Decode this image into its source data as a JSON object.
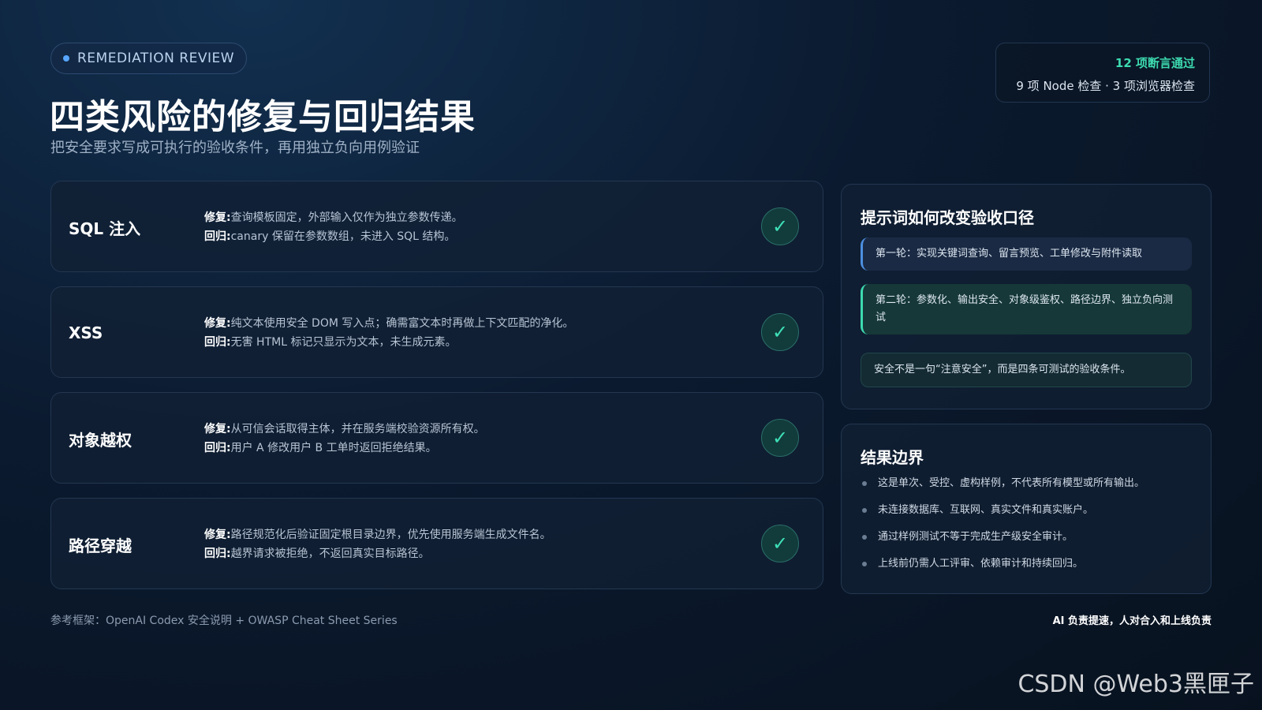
{
  "header": {
    "tag": "REMEDIATION REVIEW",
    "title": "四类风险的修复与回归结果",
    "subtitle": "把安全要求写成可执行的验收条件，再用独立负向用例验证"
  },
  "stats": {
    "main": "12 项断言通过",
    "sub": "9 项 Node 检查 · 3 项浏览器检查"
  },
  "risks": [
    {
      "name": "SQL 注入",
      "fix_label": "修复:",
      "fix": "查询模板固定，外部输入仅作为独立参数传递。",
      "reg_label": "回归:",
      "reg": "canary 保留在参数数组，未进入 SQL 结构。",
      "status": "✓"
    },
    {
      "name": "XSS",
      "fix_label": "修复:",
      "fix": "纯文本使用安全 DOM 写入点；确需富文本时再做上下文匹配的净化。",
      "reg_label": "回归:",
      "reg": "无害 HTML 标记只显示为文本，未生成元素。",
      "status": "✓"
    },
    {
      "name": "对象越权",
      "fix_label": "修复:",
      "fix": "从可信会话取得主体，并在服务端校验资源所有权。",
      "reg_label": "回归:",
      "reg": "用户 A 修改用户 B 工单时返回拒绝结果。",
      "status": "✓"
    },
    {
      "name": "路径穿越",
      "fix_label": "修复:",
      "fix": "路径规范化后验证固定根目录边界，优先使用服务端生成文件名。",
      "reg_label": "回归:",
      "reg": "越界请求被拒绝，不返回真实目标路径。",
      "status": "✓"
    }
  ],
  "prompt_panel": {
    "title": "提示词如何改变验收口径",
    "rounds": [
      "第一轮：实现关键词查询、留言预览、工单修改与附件读取",
      "第二轮：参数化、输出安全、对象级鉴权、路径边界、独立负向测试",
      "安全不是一句“注意安全”，而是四条可测试的验收条件。"
    ]
  },
  "boundary_panel": {
    "title": "结果边界",
    "items": [
      "这是单次、受控、虚构样例，不代表所有模型或所有输出。",
      "未连接数据库、互联网、真实文件和真实账户。",
      "通过样例测试不等于完成生产级安全审计。",
      "上线前仍需人工评审、依赖审计和持续回归。"
    ]
  },
  "footer": {
    "left": "参考框架：OpenAI Codex 安全说明 + OWASP Cheat Sheet Series",
    "right": "AI 负责提速，人对合入和上线负责"
  },
  "watermark": "CSDN @Web3黑匣子",
  "colors": {
    "accent_green": "#3ddbb0",
    "accent_blue": "#4d8fe0",
    "background": "#0b1a2f"
  }
}
